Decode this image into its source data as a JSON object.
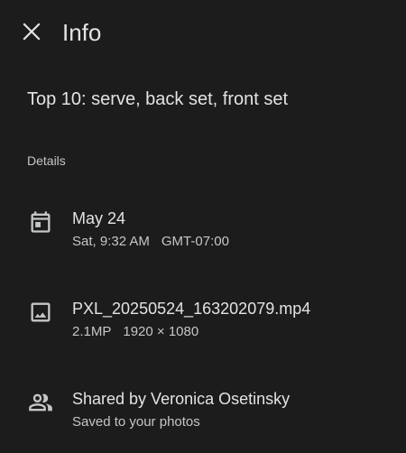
{
  "header": {
    "close_icon": "close-icon",
    "title": "Info"
  },
  "caption": "Top 10: serve, back set, front set",
  "details": {
    "label": "Details",
    "date": {
      "icon": "calendar-icon",
      "date": "May 24",
      "time": "Sat, 9:32 AM",
      "timezone": "GMT-07:00"
    },
    "file": {
      "icon": "image-icon",
      "filename": "PXL_20250524_163202079.mp4",
      "megapixels": "2.1MP",
      "resolution": "1920 × 1080"
    },
    "shared": {
      "icon": "people-icon",
      "shared_by": "Shared by Veronica Osetinsky",
      "status": "Saved to your photos"
    }
  },
  "colors": {
    "background": "#1c1c1c",
    "primary_text": "#e3e3e3",
    "secondary_text": "#c4c7c5"
  }
}
